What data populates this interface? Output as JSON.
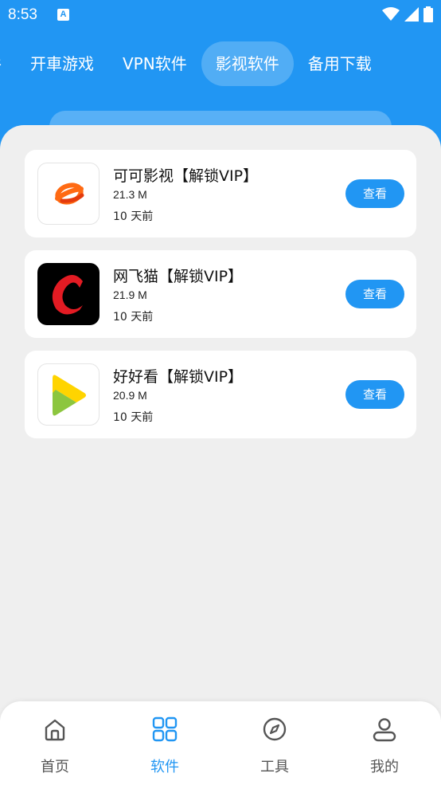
{
  "status": {
    "time": "8:53",
    "notif_icon": "A"
  },
  "tabs": [
    {
      "label": "件",
      "active": false
    },
    {
      "label": "开車游戏",
      "active": false
    },
    {
      "label": "VPN软件",
      "active": false
    },
    {
      "label": "影视软件",
      "active": true
    },
    {
      "label": "备用下载",
      "active": false
    }
  ],
  "apps": [
    {
      "name": "可可影视【解锁VIP】",
      "size": "21.3 M",
      "time": "10 天前",
      "button": "查看",
      "icon": "kekeyingshi-logo-icon"
    },
    {
      "name": "网飞猫【解锁VIP】",
      "size": "21.9 M",
      "time": "10 天前",
      "button": "查看",
      "icon": "wangfeimao-logo-icon"
    },
    {
      "name": "好好看【解锁VIP】",
      "size": "20.9 M",
      "time": "10 天前",
      "button": "查看",
      "icon": "haohaokan-logo-icon"
    }
  ],
  "nav": [
    {
      "label": "首页",
      "icon": "home-icon",
      "active": false
    },
    {
      "label": "软件",
      "icon": "grid-icon",
      "active": true
    },
    {
      "label": "工具",
      "icon": "compass-icon",
      "active": false
    },
    {
      "label": "我的",
      "icon": "user-icon",
      "active": false
    }
  ],
  "colors": {
    "primary": "#2196f3",
    "background": "#efefef"
  }
}
